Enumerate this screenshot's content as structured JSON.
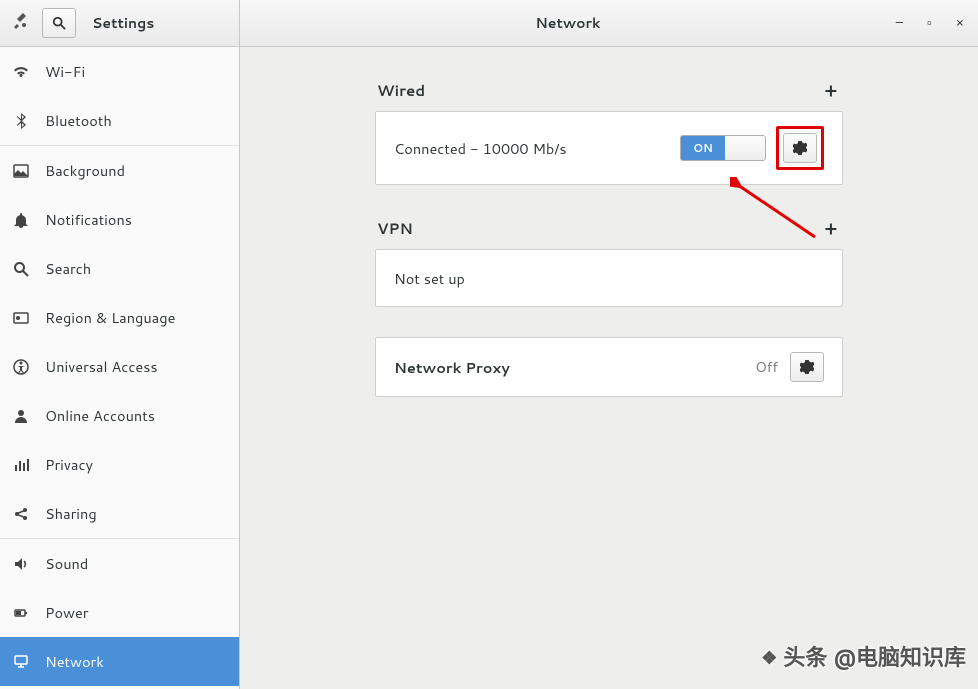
{
  "titlebar": {
    "settings_label": "Settings",
    "page_title": "Network"
  },
  "sidebar": {
    "items": [
      {
        "label": "Wi-Fi"
      },
      {
        "label": "Bluetooth"
      },
      {
        "label": "Background"
      },
      {
        "label": "Notifications"
      },
      {
        "label": "Search"
      },
      {
        "label": "Region & Language"
      },
      {
        "label": "Universal Access"
      },
      {
        "label": "Online Accounts"
      },
      {
        "label": "Privacy"
      },
      {
        "label": "Sharing"
      },
      {
        "label": "Sound"
      },
      {
        "label": "Power"
      },
      {
        "label": "Network"
      }
    ]
  },
  "wired": {
    "title": "Wired",
    "status": "Connected - 10000 Mb/s",
    "toggle": "ON"
  },
  "vpn": {
    "title": "VPN",
    "status": "Not set up"
  },
  "proxy": {
    "title": "Network Proxy",
    "status": "Off"
  },
  "watermark": {
    "text": "头条 @电脑知识库"
  }
}
